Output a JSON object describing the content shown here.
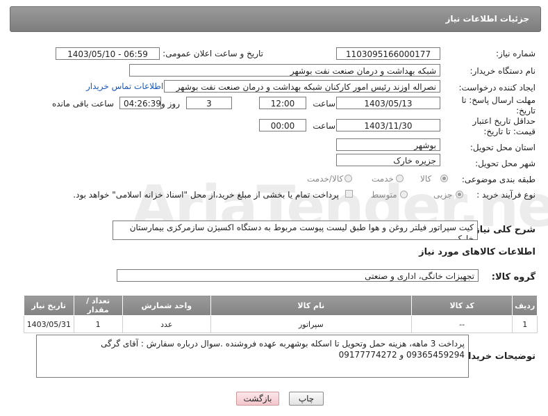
{
  "header": {
    "title": "جزئیات اطلاعات نیاز"
  },
  "fields": {
    "need_number_label": "شماره نیاز:",
    "need_number": "1103095166000177",
    "announce_label": "تاریخ و ساعت اعلان عمومی:",
    "announce_value": "1403/05/10 - 06:59",
    "buyer_org_label": "نام دستگاه خریدار:",
    "buyer_org": "شبکه بهداشت و درمان صنعت نفت بوشهر",
    "creator_label": "ایجاد کننده درخواست:",
    "creator": "نصراله اوزند رئیس امور کارکنان شبکه بهداشت و درمان صنعت نفت بوشهر",
    "contact_link": "اطلاعات تماس خریدار",
    "deadline_label": "مهلت ارسال پاسخ: تا تاریخ:",
    "deadline_date": "1403/05/13",
    "time_label": "ساعت",
    "deadline_time": "12:00",
    "days_count": "3",
    "days_and_label": "روز و",
    "remaining_time": "04:26:39",
    "remaining_label": "ساعت باقی مانده",
    "validity_label": "حداقل تاریخ اعتبار قیمت: تا تاریخ:",
    "validity_date": "1403/11/30",
    "validity_time_label": "ساعت",
    "validity_time": "00:00",
    "province_label": "استان محل تحویل:",
    "province": "بوشهر",
    "city_label": "شهر محل تحویل:",
    "city": "جزیره خارک",
    "category_label": "طبقه بندی موضوعی:",
    "category_options": [
      "کالا",
      "خدمت",
      "کالا/خدمت"
    ],
    "process_label": "نوع فرآیند خرید :",
    "process_options": [
      "جزیی",
      "متوسط"
    ],
    "payment_note": "پرداخت تمام یا بخشی از مبلغ خرید،از محل \"اسناد خزانه اسلامی\" خواهد بود."
  },
  "description": {
    "label": "شرح کلی نیاز:",
    "text": "کیت سپراتور فیلتر روغن و هوا طبق لیست پیوست مربوط به دستگاه اکسیژن سازمرکزی بیمارستان خارک"
  },
  "goods_info_title": "اطلاعات کالاهای مورد نیاز",
  "goods_group": {
    "label": "گروه کالا:",
    "value": "تجهیزات خانگی، اداری و صنعتی"
  },
  "table": {
    "headers": [
      "ردیف",
      "کد کالا",
      "نام کالا",
      "واحد شمارش",
      "تعداد / مقدار",
      "تاریخ نیاز"
    ],
    "rows": [
      [
        "1",
        "--",
        "سپراتور",
        "عدد",
        "1",
        "1403/05/31"
      ]
    ]
  },
  "buyer_notes": {
    "label": "توضیحات خریدار:",
    "text": "پرداخت 3 ماهه، هزینه حمل وتحویل تا اسکله بوشهربه عهده فروشنده .سوال درباره سفارش : آقای گرگی 09365459294 و 09177774272"
  },
  "buttons": {
    "print": "چاپ",
    "back": "بازگشت"
  },
  "watermark": "AriaTender.net"
}
